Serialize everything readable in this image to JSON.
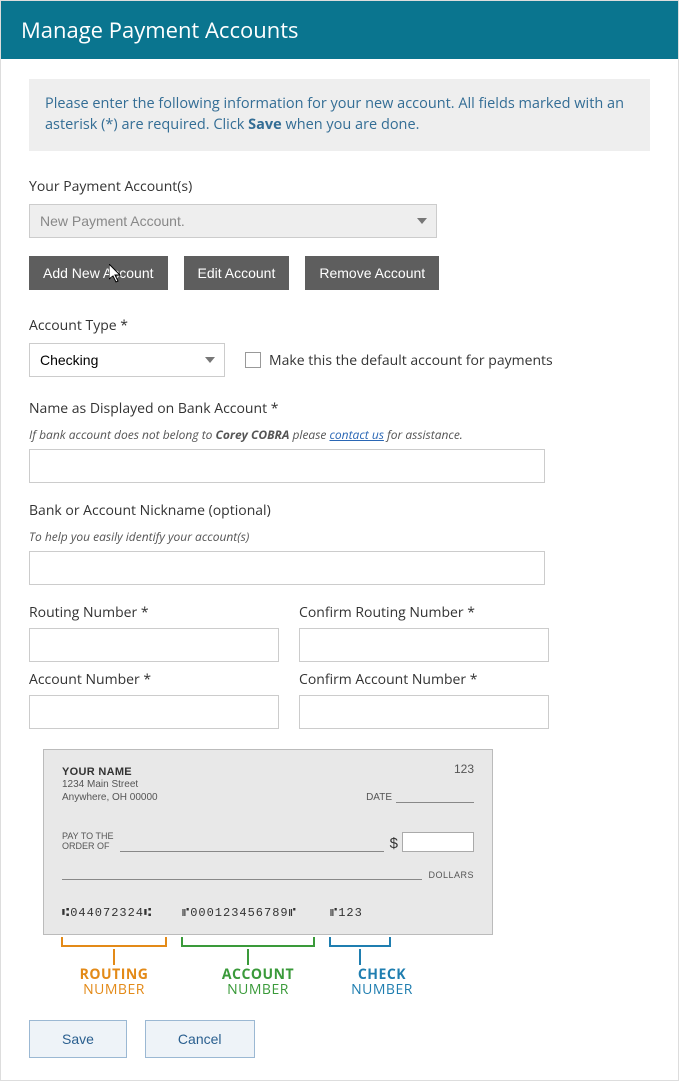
{
  "header": {
    "title": "Manage Payment Accounts"
  },
  "info": {
    "prefix": "Please enter the following information for your new account. All fields marked with an asterisk (*) are required. Click ",
    "strong": "Save",
    "suffix": " when you are done."
  },
  "accounts": {
    "label": "Your Payment Account(s)",
    "selected": "New Payment Account.",
    "buttons": {
      "add": "Add New Account",
      "edit": "Edit Account",
      "remove": "Remove Account"
    }
  },
  "account_type": {
    "label": "Account Type *",
    "value": "Checking",
    "default_label": "Make this the default account for payments"
  },
  "display_name": {
    "label": "Name as Displayed on Bank Account *",
    "helper_prefix": "If bank account does not belong to ",
    "helper_name": "Corey COBRA",
    "helper_mid": " please ",
    "helper_link": "contact us",
    "helper_suffix": " for assistance.",
    "value": ""
  },
  "nickname": {
    "label": "Bank or Account Nickname (optional)",
    "helper": "To help you easily identify your account(s)",
    "value": ""
  },
  "routing": {
    "label": "Routing Number *",
    "confirm_label": "Confirm Routing Number *",
    "value": "",
    "confirm_value": ""
  },
  "account_no": {
    "label": "Account Number *",
    "confirm_label": "Confirm Account Number *",
    "value": "",
    "confirm_value": ""
  },
  "check": {
    "name": "YOUR NAME",
    "addr1": "1234 Main Street",
    "addr2": "Anywhere, OH 00000",
    "number": "123",
    "date_label": "DATE",
    "pay_label": "PAY TO THE ORDER OF",
    "dollar": "$",
    "dollars_word": "DOLLARS",
    "routing_digits": "⑆044072324⑆",
    "account_digits": "⑈000123456789⑈",
    "check_digits": "⑈123",
    "legend": {
      "routing_top": "ROUTING",
      "routing_bot": "NUMBER",
      "account_top": "ACCOUNT",
      "account_bot": "NUMBER",
      "check_top": "CHECK",
      "check_bot": "NUMBER"
    }
  },
  "footer": {
    "save": "Save",
    "cancel": "Cancel"
  }
}
